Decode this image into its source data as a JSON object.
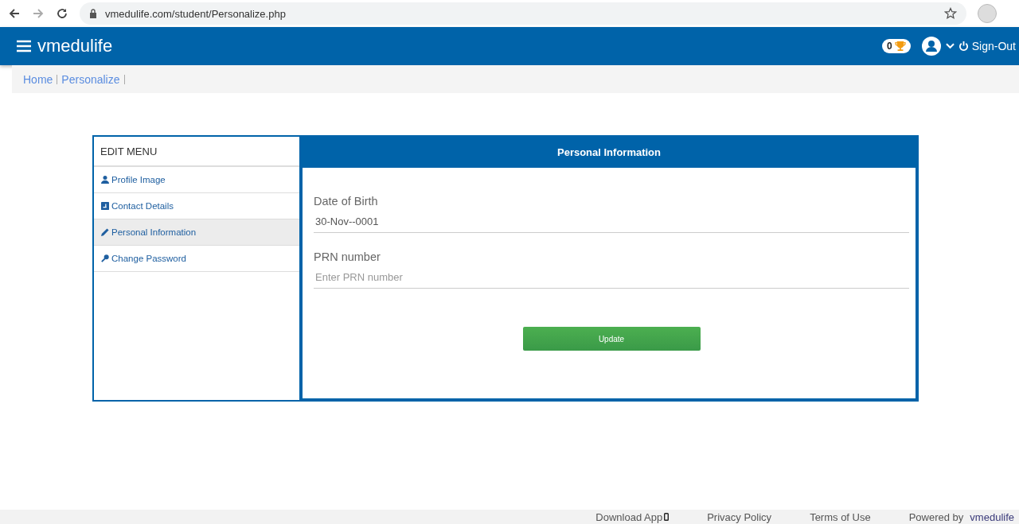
{
  "browser": {
    "url": "vmedulife.com/student/Personalize.php"
  },
  "header": {
    "brand": "vmedulife",
    "badge_count": "0",
    "sign_out": "Sign-Out"
  },
  "breadcrumb": [
    {
      "label": "Home"
    },
    {
      "label": "Personalize"
    }
  ],
  "edit_menu": {
    "title": "EDIT MENU",
    "items": [
      {
        "label": "Profile Image",
        "kind": "user",
        "selected": false
      },
      {
        "label": "Contact Details",
        "kind": "contact",
        "selected": false
      },
      {
        "label": "Personal Information",
        "kind": "pencil",
        "selected": true
      },
      {
        "label": "Change Password",
        "kind": "key",
        "selected": false
      }
    ]
  },
  "panel": {
    "title": "Personal Information",
    "fields": [
      {
        "label": "Date of Birth",
        "value": "30-Nov--0001"
      },
      {
        "label": "PRN number",
        "placeholder": "Enter PRN number"
      }
    ],
    "button": "Update"
  },
  "footer": {
    "links": [
      "Download App",
      "Privacy Policy",
      "Terms of Use"
    ],
    "powered_by": "Powered by",
    "brand": "vmedulife"
  }
}
